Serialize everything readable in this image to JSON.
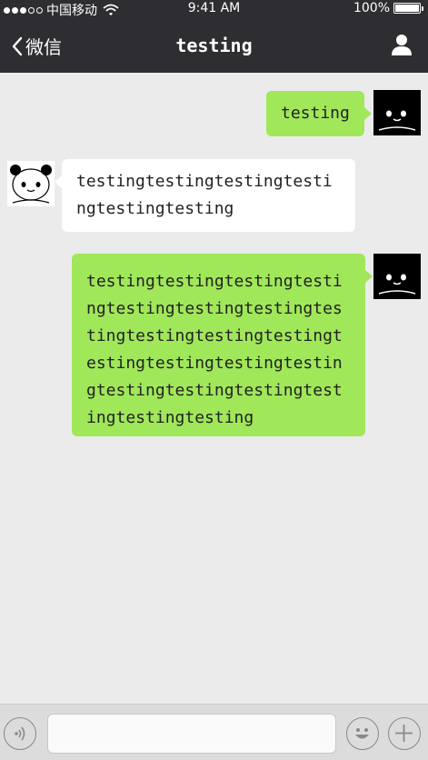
{
  "status_bar": {
    "carrier": "中国移动",
    "time": "9:41 AM",
    "battery": "100%",
    "battery_level": 1.0
  },
  "nav": {
    "back_label": "微信",
    "title": "testing"
  },
  "messages": [
    {
      "sender": "me",
      "text": "testing"
    },
    {
      "sender": "other",
      "text": "testingtestingtestingtestingtestingtesting"
    },
    {
      "sender": "me",
      "text": "testingtestingtestingtestingtestingtestingtestingtestingtestingtestingtestingtestingtestingtestingtestingtestingtestingtestingtestingtestingtesting"
    }
  ],
  "input": {
    "placeholder": ""
  },
  "colors": {
    "nav_background": "#2e2e32",
    "chat_background": "#ebebeb",
    "my_bubble": "#a0e75a",
    "other_bubble": "#ffffff"
  },
  "icons": [
    "back-chevron-icon",
    "contact-icon",
    "voice-icon",
    "emoji-icon",
    "plus-icon",
    "wifi-icon",
    "battery-icon"
  ]
}
